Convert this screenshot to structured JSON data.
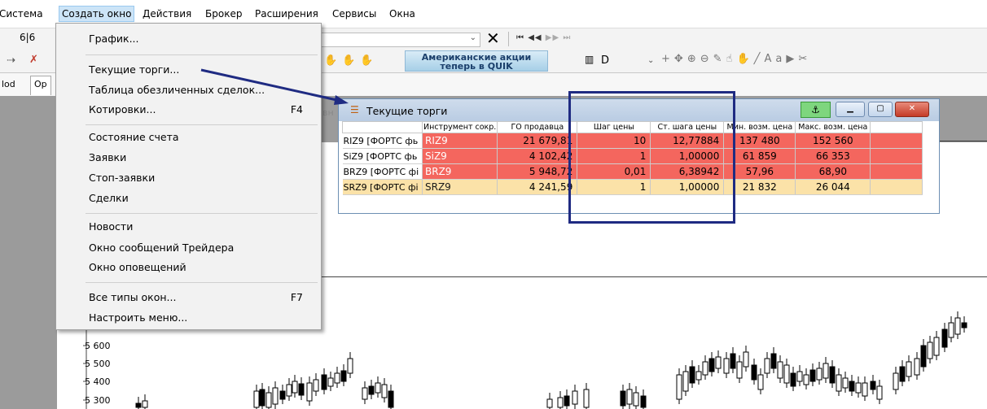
{
  "menubar": {
    "items": [
      "Система",
      "Создать окно",
      "Действия",
      "Брокер",
      "Расширения",
      "Сервисы",
      "Окна"
    ]
  },
  "toolbar": {
    "counter": "6|6",
    "nav_buttons": [
      "⏮",
      "◀◀",
      "▶▶",
      "⏭"
    ],
    "banner_line1": "Американские акции",
    "banner_line2": "теперь в QUIK",
    "interval_value": "D",
    "font_button": "Aa"
  },
  "tabs": [
    "lod",
    "Op"
  ],
  "dropdown": {
    "groups": [
      [
        {
          "label": "График...",
          "shortcut": ""
        }
      ],
      [
        {
          "label": "Текущие торги...",
          "shortcut": ""
        },
        {
          "label": "Таблица обезличенных сделок...",
          "shortcut": ""
        },
        {
          "label": "Котировки...",
          "shortcut": "F4"
        }
      ],
      [
        {
          "label": "Состояние счета",
          "shortcut": ""
        },
        {
          "label": "Заявки",
          "shortcut": ""
        },
        {
          "label": "Стоп-заявки",
          "shortcut": ""
        },
        {
          "label": "Сделки",
          "shortcut": ""
        }
      ],
      [
        {
          "label": "Новости",
          "shortcut": ""
        },
        {
          "label": "Окно сообщений Трейдера",
          "shortcut": ""
        },
        {
          "label": "Окно оповещений",
          "shortcut": ""
        }
      ],
      [
        {
          "label": "Все типы окон...",
          "shortcut": "F7"
        },
        {
          "label": "Настроить меню...",
          "shortcut": ""
        }
      ]
    ]
  },
  "trades_window": {
    "title": "Текущие торги",
    "side_stub": "вн",
    "columns": [
      "",
      "Инструмент сокр.",
      "ГО продавца",
      "Шаг цены",
      "Ст. шага цены",
      "Мин. возм. цена",
      "Макс. возм. цена",
      ""
    ],
    "rows": [
      {
        "name": "RIZ9 [ФОРТС фь",
        "code": "RIZ9",
        "go": "21 679,81",
        "step": "10",
        "step_cost": "12,77884",
        "min": "137 480",
        "max": "152 560",
        "highlight": "red"
      },
      {
        "name": "SiZ9 [ФОРТС фь",
        "code": "SiZ9",
        "go": "4 102,42",
        "step": "1",
        "step_cost": "1,00000",
        "min": "61 859",
        "max": "66 353",
        "highlight": "red"
      },
      {
        "name": "BRZ9 [ФОРТС фі",
        "code": "BRZ9",
        "go": "5 948,72",
        "step": "0,01",
        "step_cost": "6,38942",
        "min": "57,96",
        "max": "68,90",
        "highlight": "red"
      },
      {
        "name": "SRZ9 [ФОРТС фі",
        "code": "SRZ9",
        "go": "4 241,59",
        "step": "1",
        "step_cost": "1,00000",
        "min": "21 832",
        "max": "26 044",
        "highlight": "yellow"
      }
    ]
  },
  "chart": {
    "y_ticks": [
      "5 600",
      "5 500",
      "5 400",
      "5 300"
    ],
    "colors": {
      "up": "#ffffff",
      "down": "#000000"
    }
  },
  "colors": {
    "menu_highlight": "#cce4f7",
    "row_red": "#f4665e",
    "row_yellow": "#fbe2a8",
    "annotation": "#1f2b82"
  }
}
